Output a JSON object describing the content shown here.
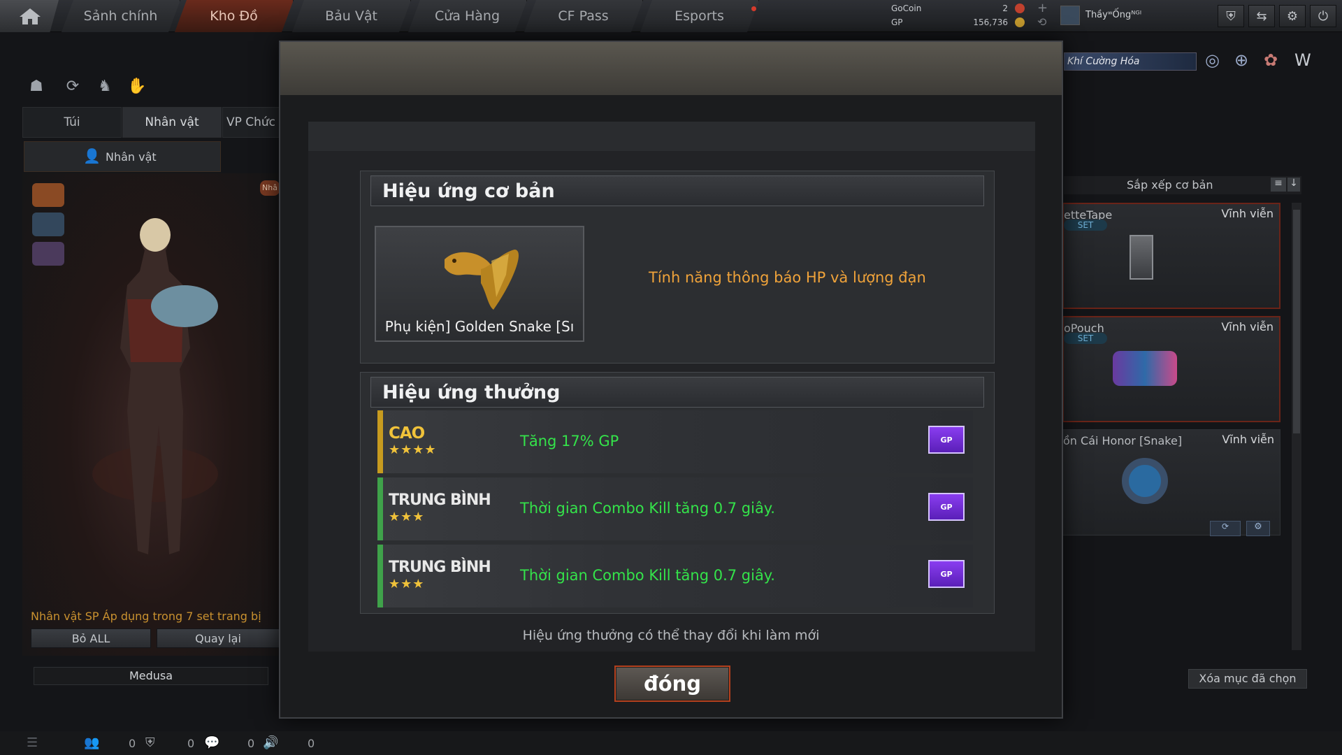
{
  "nav": {
    "tabs": [
      "Sảnh chính",
      "Kho Đồ",
      "Bảu Vật",
      "Cửa Hàng",
      "CF Pass",
      "Esports"
    ],
    "active": "Kho Đồ"
  },
  "currency": {
    "gocoin_label": "GoCoin",
    "gocoin_value": "2",
    "gp_label": "GP",
    "gp_value": "156,736"
  },
  "user": {
    "name": "ThầyʷỐngᴺᴳᴵ"
  },
  "promo": {
    "text": "Khí Cường Hóa"
  },
  "left": {
    "tabs": [
      "Túi",
      "Nhân vật",
      "VP Chức"
    ],
    "subtab": "Nhân vật",
    "info": "Nhân vật SP Áp dụng trong 7 set trang bị",
    "reset_all": "Bỏ ALL",
    "back": "Quay lại",
    "character_name": "Medusa",
    "badge": "Nhâ"
  },
  "right": {
    "sort_label": "Sắp xếp cơ bản",
    "items": [
      {
        "name": "etteTape",
        "duration": "Vĩnh viễn",
        "set": "SET"
      },
      {
        "name": "oPouch",
        "duration": "Vĩnh viễn",
        "set": "SET"
      },
      {
        "name": "ồn Cái Honor [Snake]",
        "duration": "Vĩnh viễn"
      }
    ],
    "clear_selected": "Xóa mục đã chọn"
  },
  "modal": {
    "basic_title": "Hiệu ứng cơ bản",
    "item_caption": "Phụ kiện] Golden Snake [Sı",
    "basic_effect": "Tính năng thông báo HP và lượng đạn",
    "bonus_title": "Hiệu ứng thưởng",
    "effects": [
      {
        "grade": "CAO",
        "stars": "★★★★",
        "text": "Tăng 17% GP",
        "btn": "GP"
      },
      {
        "grade": "TRUNG BÌNH",
        "stars": "★★★",
        "text": "Thời gian Combo Kill tăng 0.7 giây.",
        "btn": "GP"
      },
      {
        "grade": "TRUNG BÌNH",
        "stars": "★★★",
        "text": "Thời gian Combo Kill tăng 0.7 giây.",
        "btn": "GP"
      }
    ],
    "note": "Hiệu ứng thưởng có thể thay đổi khi làm mới",
    "close": "đóng"
  },
  "bottom": {
    "stats": [
      "0",
      "0",
      "0",
      "0"
    ]
  },
  "colors": {
    "accent": "#b3401e",
    "effect_text": "#34e34a",
    "basic_effect": "#f0a33a",
    "gp_button": "#7a33e0"
  }
}
